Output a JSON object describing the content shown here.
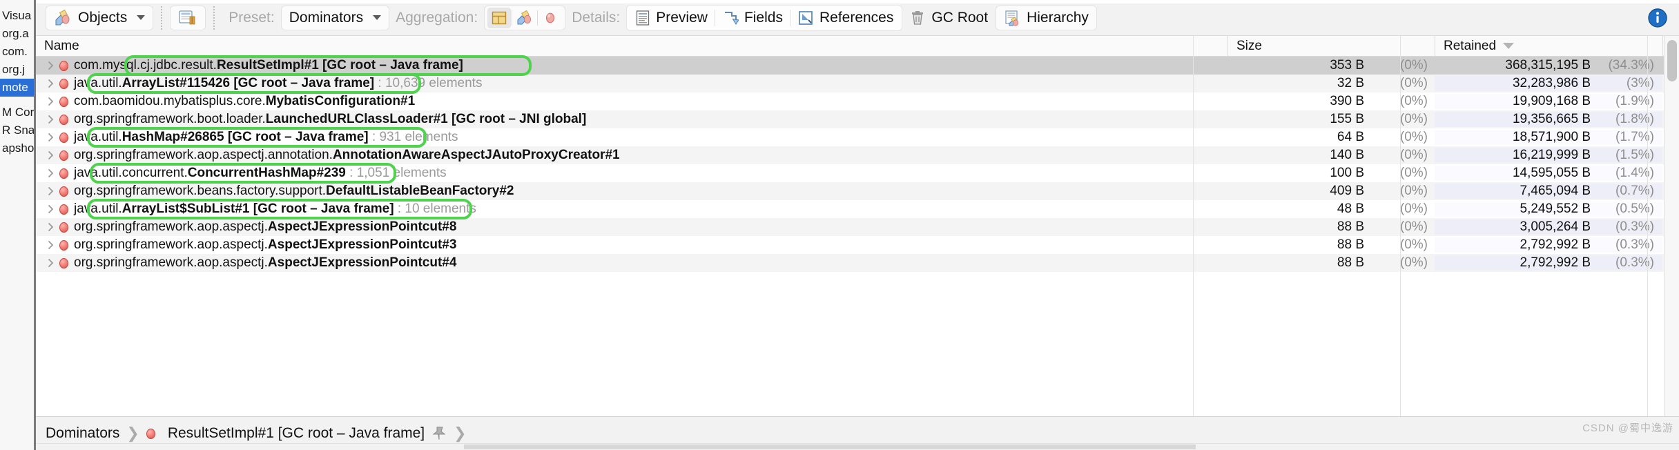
{
  "left_panel": {
    "items": [
      {
        "label": "Visua",
        "selected": false
      },
      {
        "label": "org.a",
        "selected": false
      },
      {
        "label": "com.",
        "selected": false
      },
      {
        "label": "org.j",
        "selected": false
      },
      {
        "label": "mote",
        "selected": true
      },
      {
        "label": "M Core",
        "selected": false
      },
      {
        "label": "R Snap",
        "selected": false
      },
      {
        "label": "apsho",
        "selected": false
      }
    ]
  },
  "toolbar": {
    "objects_label": "Objects",
    "objects_icon": "objects-icon",
    "snapshot_icon": "snapshot-compare-icon",
    "preset_label": "Preset:",
    "preset_value": "Dominators",
    "aggregation_label": "Aggregation:",
    "aggregation_icons": [
      "classes-grid-icon",
      "packages-icon",
      "instances-icon"
    ],
    "aggregation_selected_index": 0,
    "details_label": "Details:",
    "details_items": [
      {
        "label": "Preview",
        "icon": "preview-icon"
      },
      {
        "label": "Fields",
        "icon": "fields-icon"
      },
      {
        "label": "References",
        "icon": "references-icon"
      }
    ],
    "gc_root_label": "GC Root",
    "gc_root_icon": "trash-icon",
    "hierarchy_label": "Hierarchy",
    "hierarchy_icon": "hierarchy-icon",
    "info_icon": "info-icon"
  },
  "table": {
    "columns": {
      "name": "Name",
      "size": "Size",
      "retained": "Retained"
    },
    "sort": {
      "column": "Retained",
      "direction": "descending"
    },
    "rows": [
      {
        "prefix": "com.mysql.cj.jdbc.result.",
        "bold": "ResultSetImpl#1",
        "suffix": " [GC root – Java frame]",
        "elements": "",
        "size": "353 B",
        "size_pct": "(0%)",
        "retained": "368,315,195 B",
        "retained_pct": "(34.3%)",
        "selected": true,
        "highlight": true
      },
      {
        "prefix": "java.util.",
        "bold": "ArrayList#115426 [GC root – Java frame]",
        "suffix": "",
        "elements": " : 10,639 elements",
        "size": "32 B",
        "size_pct": "(0%)",
        "retained": "32,283,986 B",
        "retained_pct": "(3%)",
        "selected": false,
        "highlight": true
      },
      {
        "prefix": "com.baomidou.mybatisplus.core.",
        "bold": "MybatisConfiguration#1",
        "suffix": "",
        "elements": "",
        "size": "390 B",
        "size_pct": "(0%)",
        "retained": "19,909,168 B",
        "retained_pct": "(1.9%)",
        "selected": false,
        "highlight": false
      },
      {
        "prefix": "org.springframework.boot.loader.",
        "bold": "LaunchedURLClassLoader#1 [GC root – JNI global]",
        "suffix": "",
        "elements": "",
        "size": "155 B",
        "size_pct": "(0%)",
        "retained": "19,356,665 B",
        "retained_pct": "(1.8%)",
        "selected": false,
        "highlight": false
      },
      {
        "prefix": "java.util.",
        "bold": "HashMap#26865 [GC root – Java frame]",
        "suffix": "",
        "elements": " : 931 elements",
        "size": "64 B",
        "size_pct": "(0%)",
        "retained": "18,571,900 B",
        "retained_pct": "(1.7%)",
        "selected": false,
        "highlight": true
      },
      {
        "prefix": "org.springframework.aop.aspectj.annotation.",
        "bold": "AnnotationAwareAspectJAutoProxyCreator#1",
        "suffix": "",
        "elements": "",
        "size": "140 B",
        "size_pct": "(0%)",
        "retained": "16,219,999 B",
        "retained_pct": "(1.5%)",
        "selected": false,
        "highlight": false
      },
      {
        "prefix": "java.util.concurrent.",
        "bold": "ConcurrentHashMap#239",
        "suffix": "",
        "elements": " : 1,051 elements",
        "size": "100 B",
        "size_pct": "(0%)",
        "retained": "14,595,055 B",
        "retained_pct": "(1.4%)",
        "selected": false,
        "highlight": true
      },
      {
        "prefix": "org.springframework.beans.factory.support.",
        "bold": "DefaultListableBeanFactory#2",
        "suffix": "",
        "elements": "",
        "size": "409 B",
        "size_pct": "(0%)",
        "retained": "7,465,094 B",
        "retained_pct": "(0.7%)",
        "selected": false,
        "highlight": false
      },
      {
        "prefix": "java.util.",
        "bold": "ArrayList$SubList#1 [GC root – Java frame]",
        "suffix": "",
        "elements": " : 10 elements",
        "size": "48 B",
        "size_pct": "(0%)",
        "retained": "5,249,552 B",
        "retained_pct": "(0.5%)",
        "selected": false,
        "highlight": true
      },
      {
        "prefix": "org.springframework.aop.aspectj.",
        "bold": "AspectJExpressionPointcut#8",
        "suffix": "",
        "elements": "",
        "size": "88 B",
        "size_pct": "(0%)",
        "retained": "3,005,264 B",
        "retained_pct": "(0.3%)",
        "selected": false,
        "highlight": false
      },
      {
        "prefix": "org.springframework.aop.aspectj.",
        "bold": "AspectJExpressionPointcut#3",
        "suffix": "",
        "elements": "",
        "size": "88 B",
        "size_pct": "(0%)",
        "retained": "2,792,992 B",
        "retained_pct": "(0.3%)",
        "selected": false,
        "highlight": false
      },
      {
        "prefix": "org.springframework.aop.aspectj.",
        "bold": "AspectJExpressionPointcut#4",
        "suffix": "",
        "elements": "",
        "size": "88 B",
        "size_pct": "(0%)",
        "retained": "2,792,992 B",
        "retained_pct": "(0.3%)",
        "selected": false,
        "highlight": false
      }
    ]
  },
  "statusbar": {
    "root_crumb": "Dominators",
    "current_crumb": "ResultSetImpl#1 [GC root – Java frame]",
    "pin_icon": "pin-icon",
    "watermark": "CSDN @蜀中逸游"
  }
}
